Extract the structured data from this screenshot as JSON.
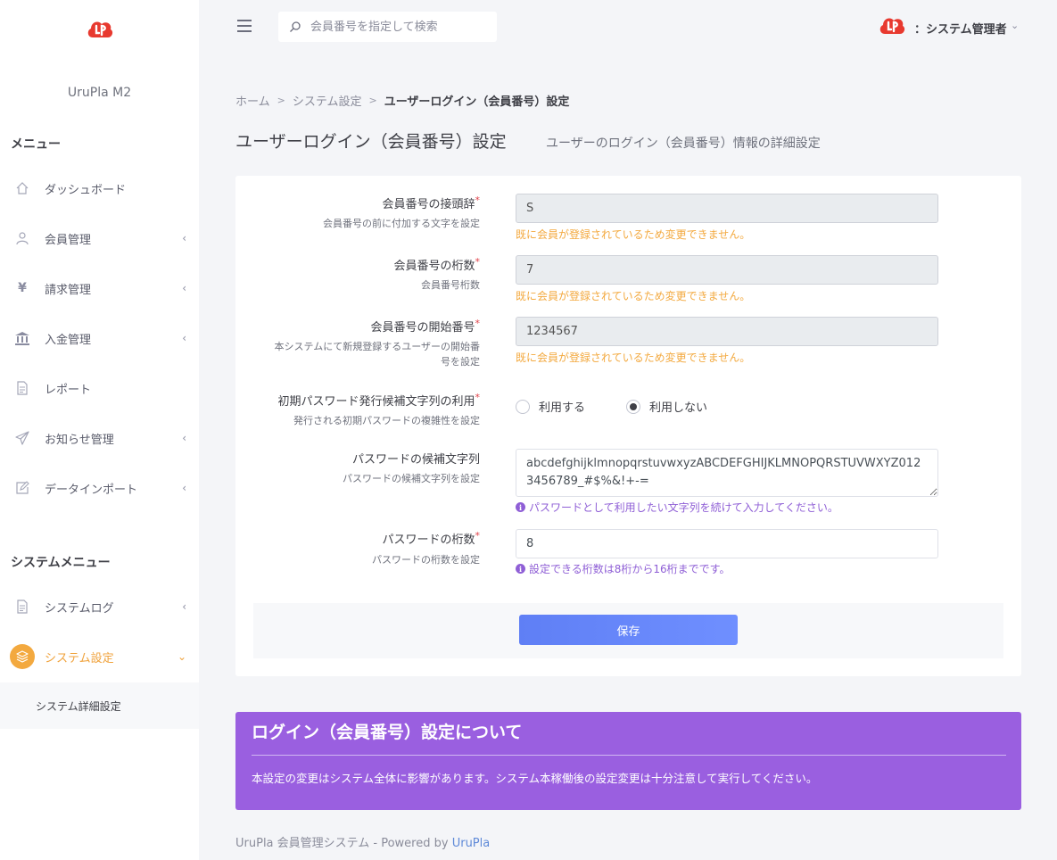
{
  "app": {
    "name": "UruPla M2"
  },
  "search": {
    "placeholder": "会員番号を指定して検索"
  },
  "user": {
    "label": "：システム管理者"
  },
  "sidebar": {
    "menu_heading": "メニュー",
    "items": [
      {
        "label": "ダッシュボード",
        "icon": "home-icon"
      },
      {
        "label": "会員管理",
        "icon": "user-icon"
      },
      {
        "label": "請求管理",
        "icon": "yen-icon"
      },
      {
        "label": "入金管理",
        "icon": "bank-icon"
      },
      {
        "label": "レポート",
        "icon": "document-icon"
      },
      {
        "label": "お知らせ管理",
        "icon": "send-icon"
      },
      {
        "label": "データインポート",
        "icon": "edit-icon"
      }
    ],
    "system_heading": "システムメニュー",
    "system_items": [
      {
        "label": "システムログ",
        "icon": "document-icon"
      },
      {
        "label": "システム設定",
        "icon": "layers-icon"
      }
    ],
    "sub_item": "システム詳細設定"
  },
  "breadcrumb": {
    "home": "ホーム",
    "sep": ">",
    "parent": "システム設定",
    "current": "ユーザーログイン（会員番号）設定"
  },
  "page": {
    "title": "ユーザーログイン（会員番号）設定",
    "subtitle": "ユーザーのログイン（会員番号）情報の詳細設定"
  },
  "form": {
    "required_mark": "*",
    "prefix": {
      "label": "会員番号の接頭辞",
      "help": "会員番号の前に付加する文字を設定",
      "value": "S",
      "warning": "既に会員が登録されているため変更できません。"
    },
    "digits": {
      "label": "会員番号の桁数",
      "help": "会員番号桁数",
      "value": "7",
      "warning": "既に会員が登録されているため変更できません。"
    },
    "start": {
      "label": "会員番号の開始番号",
      "help_line1": "本システムにて新規登録するユーザーの開始番",
      "help_line2": "号を設定",
      "value": "1234567",
      "warning": "既に会員が登録されているため変更できません。"
    },
    "initial_pw": {
      "label": "初期パスワード発行候補文字列の利用",
      "help": "発行される初期パスワードの複雑性を設定",
      "options": [
        "利用する",
        "利用しない"
      ],
      "selected": "利用しない"
    },
    "pw_chars": {
      "label": "パスワードの候補文字列",
      "help": "パスワードの候補文字列を設定",
      "value": "abcdefghijklmnopqrstuvwxyzABCDEFGHIJKLMNOPQRSTUVWXYZ0123456789_#$%&!+-=",
      "info": "パスワードとして利用したい文字列を続けて入力してください。"
    },
    "pw_length": {
      "label": "パスワードの桁数",
      "help": "パスワードの桁数を設定",
      "value": "8",
      "info": "設定できる桁数は8桁から16桁までです。"
    },
    "save_label": "保存"
  },
  "notice": {
    "title": "ログイン（会員番号）設定について",
    "body": "本設定の変更はシステム全体に影響があります。システム本稼働後の設定変更は十分注意して実行してください。"
  },
  "footer": {
    "text": "UruPla 会員管理システム - Powered by ",
    "link": "UruPla"
  },
  "colors": {
    "accent": "#f3a93f",
    "brand_red": "#e8392f",
    "notice_bg": "#9a5fe0",
    "info_purple": "#8f5fd6",
    "save_button": "#6380f7"
  }
}
